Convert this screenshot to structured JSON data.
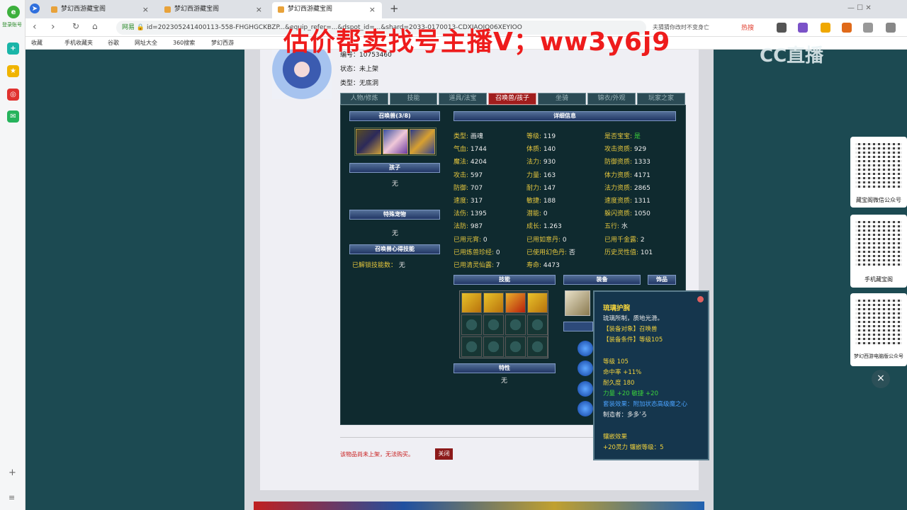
{
  "overlay_text": "估价帮卖找号主播V；ww3y6j9",
  "watermark": "CC直播",
  "browser": {
    "tabs": [
      {
        "label": "梦幻西游藏宝阁"
      },
      {
        "label": "梦幻西游藏宝阁"
      },
      {
        "label": "梦幻西游藏宝阁"
      }
    ],
    "new_tab": "+",
    "url_secure": "网易",
    "url": "id=202305241400113-558-FHGHGCKBZP...&equip_refer=...&dspot_id=...&shard=2033-0170013-CDXJAOJO06XEYIOO",
    "url_hint": "夫猜猜你改时不变身亡",
    "hot_label": "热搜",
    "bookmarks": [
      "收藏",
      "手机收藏夹",
      "谷歌",
      "网址大全",
      "360搜索",
      "梦幻西游"
    ],
    "leftbar_label": "登录账号"
  },
  "role": {
    "id_label": "编号：",
    "id_value": "10753460",
    "status_label": "状态：",
    "status_value": "未上架",
    "type_label": "类型：",
    "type_value": "无底洞"
  },
  "top_tabs": [
    "人物/修炼",
    "技能",
    "道具/法宝",
    "召唤兽/孩子",
    "坐骑",
    "锦衣/外观",
    "玩家之家"
  ],
  "left_col": {
    "summon_header": "召唤兽(3/8)",
    "child_header": "孩子",
    "child_value": "无",
    "special_header": "特殊宠物",
    "special_value": "无",
    "skill_header": "召唤兽心得技能",
    "unlocked_label": "已解锁技能数：",
    "unlocked_value": "无"
  },
  "detail_header": "详细信息",
  "stats": [
    [
      {
        "k": "类型:",
        "v": "画魂"
      },
      {
        "k": "等级:",
        "v": "119"
      },
      {
        "k": "是否宝宝:",
        "v": "是"
      }
    ],
    [
      {
        "k": "气血:",
        "v": "1744"
      },
      {
        "k": "体质:",
        "v": "140"
      },
      {
        "k": "攻击资质:",
        "v": "929"
      }
    ],
    [
      {
        "k": "魔法:",
        "v": "4204"
      },
      {
        "k": "法力:",
        "v": "930"
      },
      {
        "k": "防御资质:",
        "v": "1333"
      }
    ],
    [
      {
        "k": "攻击:",
        "v": "597"
      },
      {
        "k": "力量:",
        "v": "163"
      },
      {
        "k": "体力资质:",
        "v": "4171"
      }
    ],
    [
      {
        "k": "防御:",
        "v": "707"
      },
      {
        "k": "耐力:",
        "v": "147"
      },
      {
        "k": "法力资质:",
        "v": "2865"
      }
    ],
    [
      {
        "k": "速度:",
        "v": "317"
      },
      {
        "k": "敏捷:",
        "v": "188"
      },
      {
        "k": "速度资质:",
        "v": "1311"
      }
    ],
    [
      {
        "k": "法伤:",
        "v": "1395"
      },
      {
        "k": "潜能:",
        "v": "0"
      },
      {
        "k": "躲闪资质:",
        "v": "1050"
      }
    ],
    [
      {
        "k": "法防:",
        "v": "987"
      },
      {
        "k": "成长:",
        "v": "1.263"
      },
      {
        "k": "五行:",
        "v": "水"
      }
    ],
    [
      {
        "k": "已用元宵:",
        "v": "0"
      },
      {
        "k": "已用如意丹:",
        "v": "0"
      },
      {
        "k": "已用千金露:",
        "v": "2"
      }
    ],
    [
      {
        "k": "已用炼兽珍经:",
        "v": "0"
      },
      {
        "k": "已使用幻色丹:",
        "v": "否"
      },
      {
        "k": "历史灵性值:",
        "v": "101"
      }
    ],
    [
      {
        "k": "已用清灵仙露:",
        "v": "7"
      },
      {
        "k": "寿命:",
        "v": "4473"
      },
      {
        "k": "",
        "v": ""
      }
    ]
  ],
  "skills_header": "技能",
  "equip_header": "装备",
  "ornament_header": "饰品",
  "trait_header": "特性",
  "trait_value": "无",
  "tooltip": {
    "title": "琉璃护腕",
    "desc": "琉璃所制，质地光滑。",
    "l1": "【装备对象】召唤兽",
    "l2": "【装备条件】等级105",
    "lv": "等级 105",
    "hit": "命中率 +11%",
    "dur": "耐久度 180",
    "attr": "力量 +20 敏捷 +20",
    "set": "套装效果：附加状态高级魔之心",
    "maker": "制造者：多多’ろ",
    "inlay_title": "镶嵌效果",
    "inlay": "+20灵力 镶嵌等级：5"
  },
  "footer": {
    "notice": "该物品尚未上架，无法购买。",
    "close_button": "关闭"
  },
  "qr_cards": [
    {
      "caption": "藏宝阁微信公众号"
    },
    {
      "caption": "手机藏宝阁"
    },
    {
      "caption": "梦幻西游电脑版公众号"
    }
  ],
  "close_x": "×"
}
